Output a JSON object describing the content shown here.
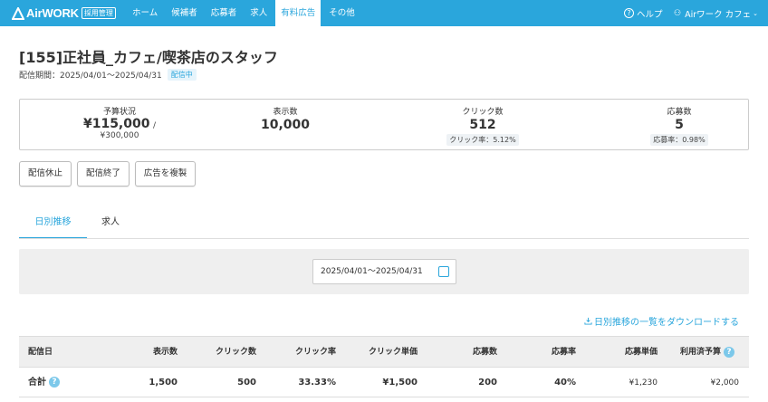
{
  "header": {
    "logo_text": "AirWORK",
    "logo_badge": "採用管理",
    "nav": [
      {
        "label": "ホーム"
      },
      {
        "label": "候補者"
      },
      {
        "label": "応募者"
      },
      {
        "label": "求人"
      },
      {
        "label": "有料広告",
        "active": true
      },
      {
        "label": "その他"
      }
    ],
    "help_label": "ヘルプ",
    "account_label": "Airワーク カフェ"
  },
  "ad": {
    "title": "[155]正社員_カフェ/喫茶店のスタッフ",
    "period": "配信期間：2025/04/01〜2025/04/31",
    "status": "配信中"
  },
  "stats": {
    "budget": {
      "label": "予算状況",
      "value": "¥115,000",
      "slash": "/",
      "total": "¥300,000"
    },
    "impressions": {
      "label": "表示数",
      "value": "10,000"
    },
    "clicks": {
      "label": "クリック数",
      "value": "512",
      "rate": "クリック率：5.12%"
    },
    "applications": {
      "label": "応募数",
      "value": "5",
      "rate": "応募率：0.98%"
    }
  },
  "actions": {
    "pause": "配信休止",
    "end": "配信終了",
    "duplicate": "広告を複製"
  },
  "tabs": [
    {
      "label": "日別推移",
      "active": true
    },
    {
      "label": "求人"
    }
  ],
  "filter": {
    "date_range": "2025/04/01〜2025/04/31"
  },
  "download_label": "日別推移の一覧をダウンロードする",
  "table": {
    "columns": [
      "配信日",
      "表示数",
      "クリック数",
      "クリック率",
      "クリック単価",
      "応募数",
      "応募率",
      "応募単価",
      "利用済予算"
    ],
    "total_row": {
      "label": "合計",
      "impressions": "1,500",
      "clicks": "500",
      "click_rate": "33.33%",
      "cpc": "¥1,500",
      "applications": "200",
      "app_rate": "40%",
      "cpa": "¥1,230",
      "used_budget": "¥2,000"
    }
  },
  "colors": {
    "brand": "#2aa6dc",
    "panel": "#efefef"
  }
}
